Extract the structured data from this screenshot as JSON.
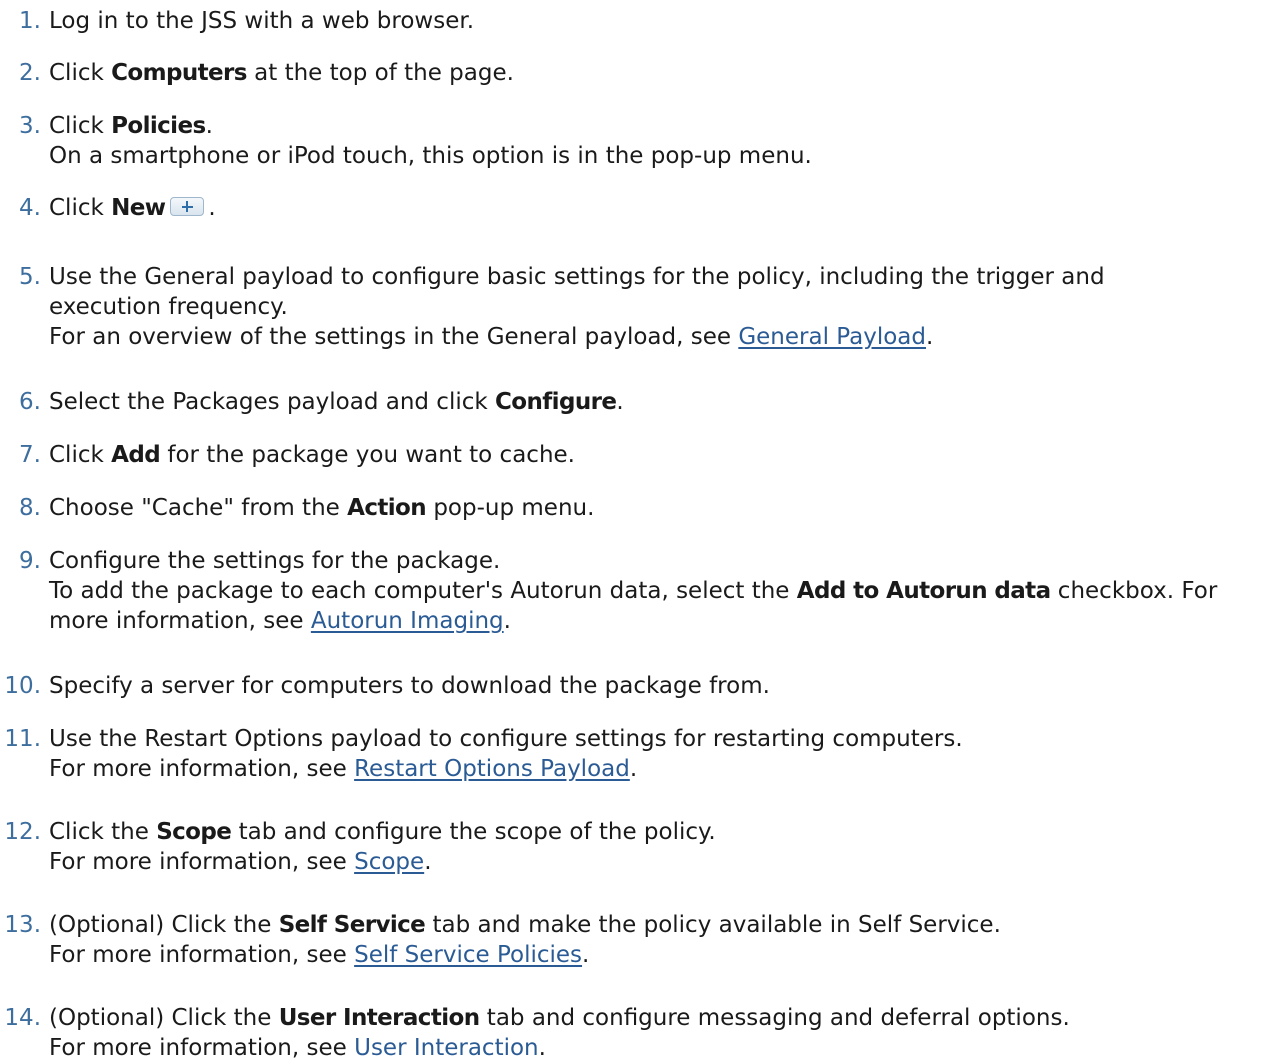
{
  "steps": [
    {
      "num": "1.",
      "text": "Log in to the JSS with a web browser."
    },
    {
      "num": "2.",
      "pre": "Click ",
      "bold": "Computers",
      "post": " at the top of the page."
    },
    {
      "num": "3.",
      "pre": "Click ",
      "bold": "Policies",
      "post": ".",
      "note": "On a smartphone or iPod touch, this option is in the pop-up menu."
    },
    {
      "num": "4.",
      "pre": "Click ",
      "bold": "New",
      "post": ".",
      "icon": "plus-icon"
    },
    {
      "num": "5.",
      "line1": "Use the General payload to configure basic settings for the policy, including the trigger and",
      "line2": "execution frequency.",
      "note_pre": "For an overview of the settings in the General payload, see ",
      "link": "General Payload",
      "note_post": "."
    },
    {
      "num": "6.",
      "pre": "Select the Packages payload and click ",
      "bold": "Configure",
      "post": "."
    },
    {
      "num": "7.",
      "pre": "Click ",
      "bold": "Add",
      "post": " for the package you want to cache."
    },
    {
      "num": "8.",
      "pre": "Choose \"Cache\" from the ",
      "bold": "Action",
      "post": " pop-up menu."
    },
    {
      "num": "9.",
      "text": "Configure the settings for the package.",
      "note_pre": "To add the package to each computer's Autorun data, select the ",
      "note_bold": "Add to Autorun data",
      "note_mid": " checkbox. For",
      "note2_pre": "more information, see ",
      "link": "Autorun Imaging",
      "note2_post": "."
    },
    {
      "num": "10.",
      "text": "Specify a server for computers to download the package from."
    },
    {
      "num": "11.",
      "text": "Use the Restart Options payload to configure settings for restarting computers.",
      "note_pre": "For more information, see ",
      "link": "Restart Options Payload",
      "note_post": "."
    },
    {
      "num": "12.",
      "pre": "Click the ",
      "bold": "Scope",
      "post": " tab and configure the scope of the policy.",
      "note_pre": "For more information, see ",
      "link": "Scope",
      "note_post": "."
    },
    {
      "num": "13.",
      "pre": "(Optional) Click the ",
      "bold": "Self Service",
      "post": " tab and make the policy available in Self Service.",
      "note_pre": "For more information, see ",
      "link": "Self Service Policies",
      "note_post": "."
    },
    {
      "num": "14.",
      "pre": "(Optional) Click the ",
      "bold": "User Interaction",
      "post": " tab and configure messaging and deferral options.",
      "note_pre": "For more information, see ",
      "link": "User Interaction",
      "note_post": "."
    }
  ]
}
